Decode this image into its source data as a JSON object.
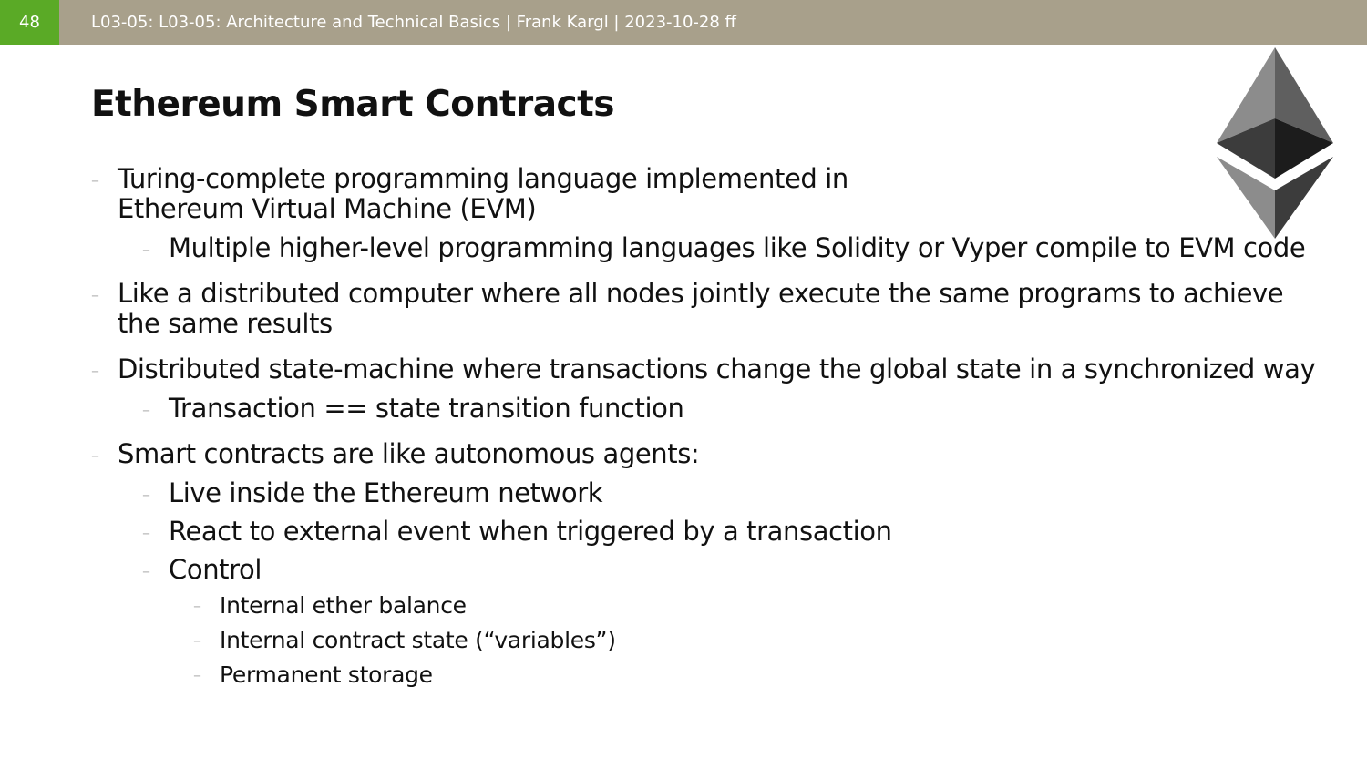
{
  "header": {
    "slide_number": "48",
    "text": "L03-05: L03-05: Architecture and Technical Basics | Frank Kargl | 2023-10-28 ff"
  },
  "slide": {
    "title": "Ethereum Smart Contracts",
    "bullet_marker": "–",
    "items": [
      {
        "text": "Turing-complete programming language implemented in",
        "text_line2": "Ethereum Virtual Machine (EVM)",
        "sub": [
          "Multiple higher-level programming languages like Solidity or Vyper compile to EVM code"
        ]
      },
      {
        "text": "Like a distributed computer where all nodes jointly execute the same programs to achieve the same results"
      },
      {
        "text": "Distributed state-machine where transactions change the global state in a synchronized way",
        "sub": [
          "Transaction == state transition function"
        ]
      },
      {
        "text": "Smart contracts are like autonomous agents:",
        "sub": [
          "Live inside the Ethereum network",
          "React to external event when triggered by a transaction",
          "Control"
        ],
        "subsub": [
          "Internal ether balance",
          "Internal contract state (“variables”)",
          "Permanent storage"
        ]
      }
    ]
  },
  "logo": {
    "icon": "ethereum-logo-icon"
  },
  "colors": {
    "header_bar": "#a8a08b",
    "slide_number_bg": "#5aaa26",
    "bullet_dash": "#bbbbbb",
    "text": "#111111"
  }
}
